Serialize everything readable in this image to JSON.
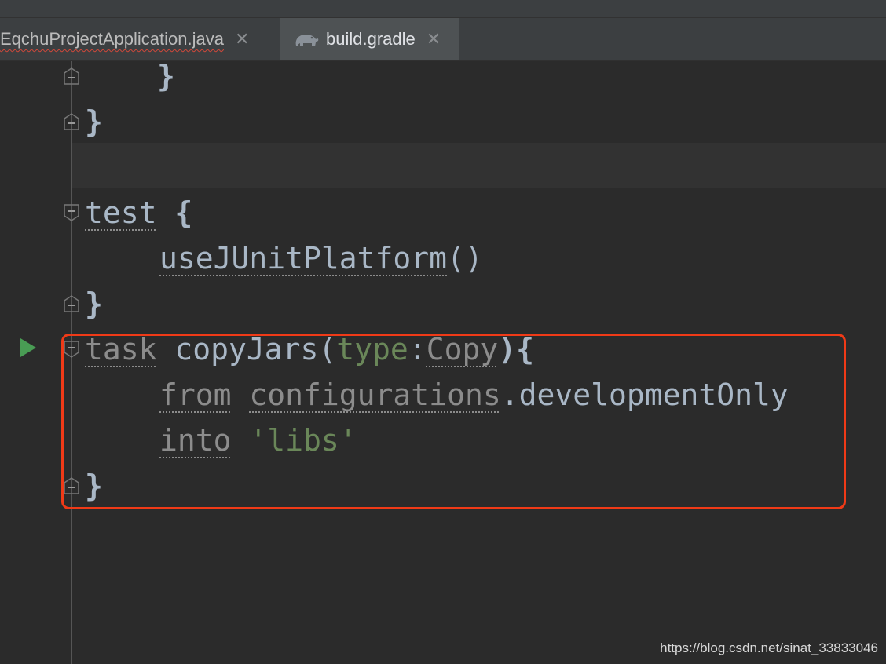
{
  "tabs": [
    {
      "label": "EqchuProjectApplication.java",
      "close": "✕",
      "active": false
    },
    {
      "label": "build.gradle",
      "close": "✕",
      "active": true,
      "icon": "gradle-elephant-icon"
    }
  ],
  "code": {
    "line1": "}",
    "line2": "}",
    "line3_kw": "test",
    "line3_rest": " {",
    "line4_call": "useJUnitPlatform",
    "line4_paren": "()",
    "line5": "}",
    "line6_task": "task",
    "line6_name": " copyJars(",
    "line6_param": "type",
    "line6_colon": ":",
    "line6_type": "Copy",
    "line6_end": "){",
    "line7_from": "from",
    "line7_sp": " ",
    "line7_conf": "configurations",
    "line7_dot": ".",
    "line7_field": "developmentOnly",
    "line8_into": "into",
    "line8_sp": " ",
    "line8_str": "'libs'",
    "line9": "}"
  },
  "gutter": {
    "run_icon": "run-triangle-icon",
    "fold_icon": "fold-marker-icon"
  },
  "colors": {
    "background": "#2b2b2b",
    "highlight_box": "#f03a17",
    "string": "#6a8759",
    "run": "#499c54"
  },
  "watermark": "https://blog.csdn.net/sinat_33833046"
}
